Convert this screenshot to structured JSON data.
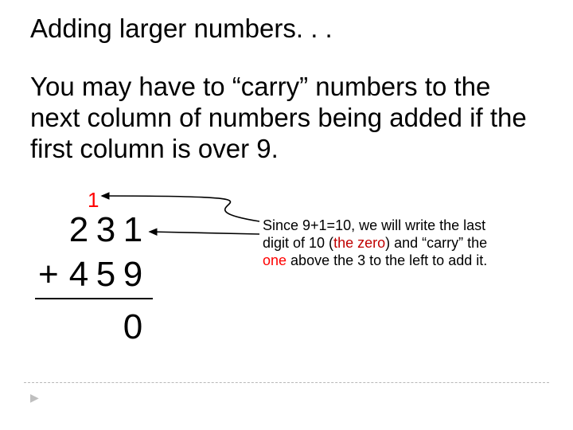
{
  "title": "Adding larger numbers. . .",
  "body": "You may have to “carry” numbers to the next column of numbers being added if the first column is over 9.",
  "carry_digit": "1",
  "problem": {
    "row1": [
      "2",
      "3",
      "1"
    ],
    "plus_sign": "+",
    "row2": [
      "4",
      "5",
      "9"
    ],
    "answer_ones": "0"
  },
  "explain": {
    "part1": "Since 9+1=10, we will write the last digit of 10 (",
    "zero_phrase": "the zero",
    "part2": ") and “carry” the ",
    "one_word": "one",
    "part3": " above the 3 to the left to add it."
  },
  "colors": {
    "carry_red": "#ff0000",
    "zero_red": "#c00000"
  }
}
